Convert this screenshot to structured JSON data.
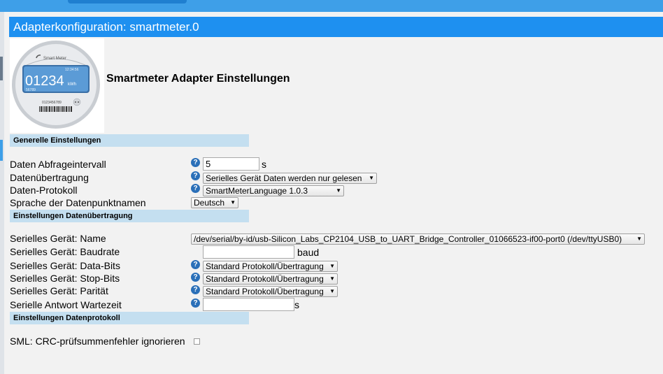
{
  "window": {
    "title": "Adapterkonfiguration: smartmeter.0"
  },
  "header": {
    "heading": "Smartmeter Adapter Einstellungen",
    "logo": {
      "brand": "Smart Meter",
      "time": "12:34:56",
      "reading": "01234",
      "unit": "kWh",
      "sub_reading": "56789",
      "serial": "0123456789"
    }
  },
  "sections": {
    "general": "Generelle Einstellungen",
    "transfer": "Einstellungen Datenübertragung",
    "protocol": "Einstellungen Datenprotokoll"
  },
  "general": {
    "interval_label": "Daten Abfrageintervall",
    "interval_value": "5",
    "interval_unit": "s",
    "transfer_label": "Datenübertragung",
    "transfer_value": "Serielles Gerät Daten werden nur gelesen",
    "protocol_label": "Daten-Protokoll",
    "protocol_value": "SmartMeterLanguage 1.0.3",
    "language_label": "Sprache der Datenpunktnamen",
    "language_value": "Deutsch"
  },
  "transfer": {
    "name_label": "Serielles Gerät: Name",
    "name_value": "/dev/serial/by-id/usb-Silicon_Labs_CP2104_USB_to_UART_Bridge_Controller_01066523-if00-port0 (/dev/ttyUSB0)",
    "baud_label": "Serielles Gerät: Baudrate",
    "baud_value": "",
    "baud_unit": "baud",
    "databits_label": "Serielles Gerät: Data-Bits",
    "databits_value": "Standard Protokoll/Übertragung",
    "stopbits_label": "Serielles Gerät: Stop-Bits",
    "stopbits_value": "Standard Protokoll/Übertragung",
    "parity_label": "Serielles Gerät: Parität",
    "parity_value": "Standard Protokoll/Übertragung",
    "timeout_label": "Serielle Antwort Wartezeit",
    "timeout_value": "",
    "timeout_unit": "s"
  },
  "protocol": {
    "crc_label": "SML: CRC-prüfsummenfehler ignorieren",
    "crc_checked": false
  },
  "icons": {
    "help": "help-icon",
    "dropdown": "chevron-down-icon"
  },
  "colors": {
    "titlebar": "#1e90f0",
    "section": "#c4dff0",
    "help": "#2a6fb8"
  }
}
